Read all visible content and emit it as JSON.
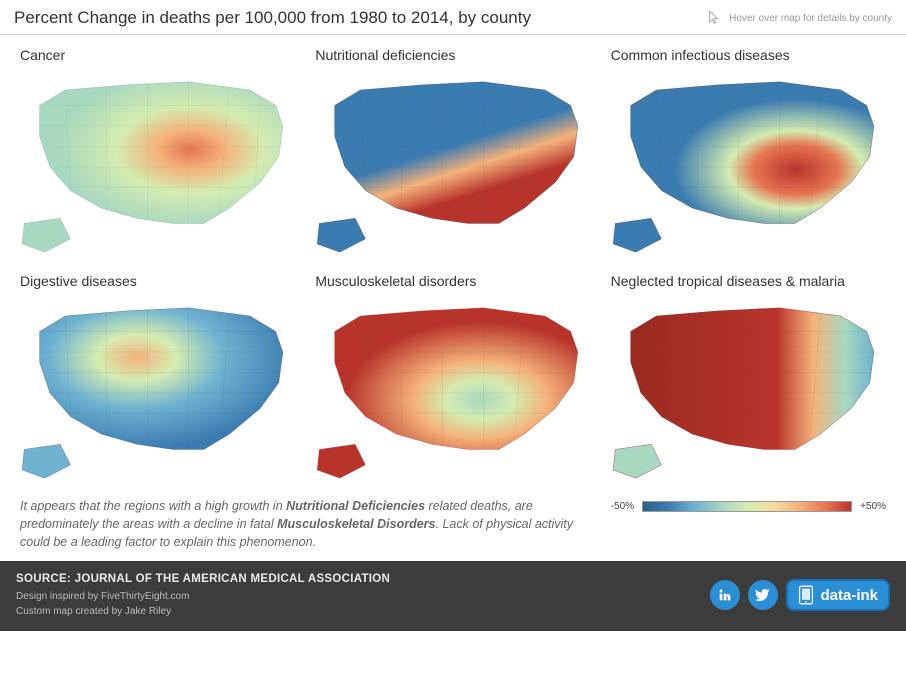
{
  "header": {
    "title": "Percent Change in deaths per 100,000 from 1980 to 2014, by county",
    "hover_hint": "Hover over map for details by county"
  },
  "panels": [
    {
      "title": "Cancer",
      "scheme": "mostly_green"
    },
    {
      "title": "Nutritional deficiencies",
      "scheme": "blue_south_red"
    },
    {
      "title": "Common infectious diseases",
      "scheme": "blue_se_red"
    },
    {
      "title": "Digestive diseases",
      "scheme": "mixed_blue_orange"
    },
    {
      "title": "Musculoskeletal disorders",
      "scheme": "mostly_red"
    },
    {
      "title": "Neglected tropical diseases & malaria",
      "scheme": "deep_red_east_blue"
    }
  ],
  "legend": {
    "min_label": "-50%",
    "max_label": "+50%"
  },
  "blurb": {
    "line1_a": "It appears that the regions with a high growth in ",
    "line1_em1": "Nutritional Deficiencies",
    "line1_b": " related deaths, are",
    "line2_a": "predominately the areas with a decline in fatal ",
    "line2_em2": "Musculoskeletal Disorders",
    "line2_b": ".  Lack of physical activity",
    "line3": "could be a leading factor to explain this phenomenon."
  },
  "footer": {
    "source": "SOURCE: JOURNAL OF THE AMERICAN MEDICAL ASSOCIATION",
    "design": "Design inspired by FiveThirtyEight.com",
    "custom": "Custom map created by Jake Riley",
    "badge_label": "data-ink"
  },
  "colors": {
    "scale_min": "#2b5f8e",
    "scale_mid_blue": "#6fb3d1",
    "scale_green": "#a8d8c0",
    "scale_yellow": "#d4ecb0",
    "scale_orange": "#f4b27a",
    "scale_red": "#b8342a",
    "footer_bg": "#3c3c3c",
    "accent_blue": "#2a8fd6"
  }
}
